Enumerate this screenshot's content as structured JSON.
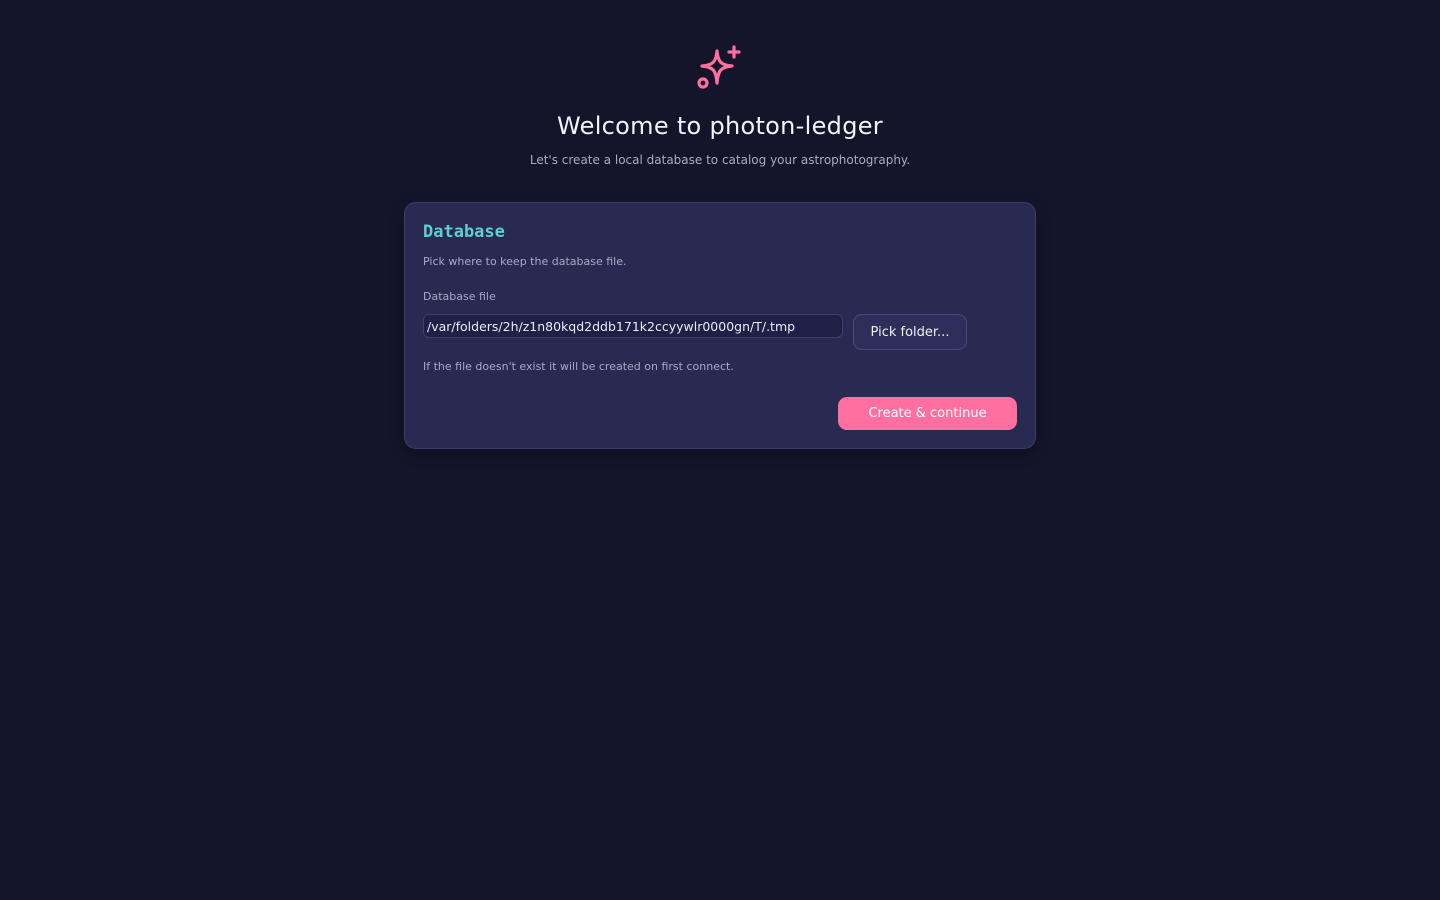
{
  "hero": {
    "icon": "sparkles-icon",
    "title": "Welcome to photon-ledger",
    "subtitle": "Let's create a local database to catalog your astrophotography."
  },
  "card": {
    "title": "Database",
    "description": "Pick where to keep the database file.",
    "field_label": "Database file",
    "path_value": "/var/folders/2h/z1n80kqd2ddb171k2ccyywlr0000gn/T/.tmp",
    "pick_button": "Pick folder...",
    "hint": "If the file doesn't exist it will be created on first connect.",
    "primary_button": "Create & continue"
  },
  "colors": {
    "background": "#14152b",
    "card": "#282a52",
    "accent_pink": "#ff6f9f",
    "accent_teal": "#5fd0cf"
  }
}
